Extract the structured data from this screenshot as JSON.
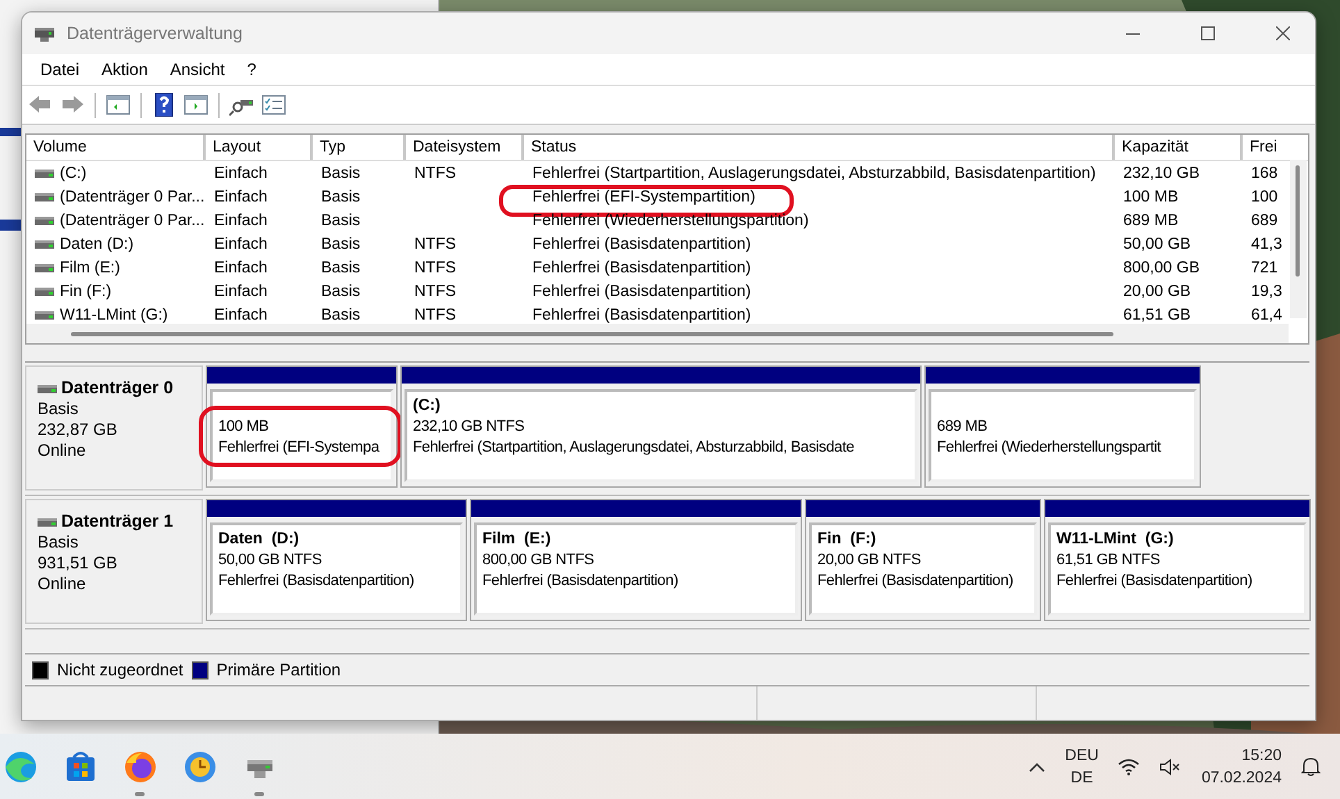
{
  "window": {
    "title": "Datenträgerverwaltung"
  },
  "menu": [
    "Datei",
    "Aktion",
    "Ansicht",
    "?"
  ],
  "volume_table": {
    "columns": [
      "Volume",
      "Layout",
      "Typ",
      "Dateisystem",
      "Status",
      "Kapazität",
      "Frei"
    ],
    "rows": [
      {
        "cells": [
          "(C:)",
          "Einfach",
          "Basis",
          "NTFS",
          "Fehlerfrei (Startpartition, Auslagerungsdatei, Absturzabbild, Basisdatenpartition)",
          "232,10 GB",
          "168"
        ],
        "annotated": false
      },
      {
        "cells": [
          "(Datenträger 0 Par...",
          "Einfach",
          "Basis",
          "",
          "Fehlerfrei (EFI-Systempartition)",
          "100 MB",
          "100"
        ],
        "annotated": true
      },
      {
        "cells": [
          "(Datenträger 0 Par...",
          "Einfach",
          "Basis",
          "",
          "Fehlerfrei (Wiederherstellungspartition)",
          "689 MB",
          "689"
        ],
        "annotated": false
      },
      {
        "cells": [
          "Daten (D:)",
          "Einfach",
          "Basis",
          "NTFS",
          "Fehlerfrei (Basisdatenpartition)",
          "50,00 GB",
          "41,3"
        ],
        "annotated": false
      },
      {
        "cells": [
          "Film (E:)",
          "Einfach",
          "Basis",
          "NTFS",
          "Fehlerfrei (Basisdatenpartition)",
          "800,00 GB",
          "721"
        ],
        "annotated": false
      },
      {
        "cells": [
          "Fin (F:)",
          "Einfach",
          "Basis",
          "NTFS",
          "Fehlerfrei (Basisdatenpartition)",
          "20,00 GB",
          "19,3"
        ],
        "annotated": false
      },
      {
        "cells": [
          "W11-LMint (G:)",
          "Einfach",
          "Basis",
          "NTFS",
          "Fehlerfrei (Basisdatenpartition)",
          "61,51 GB",
          "61,4"
        ],
        "annotated": false
      }
    ]
  },
  "disks": [
    {
      "name": "Datenträger 0",
      "type": "Basis",
      "size": "232,87 GB",
      "status": "Online",
      "partitions": [
        {
          "size": "100 MB",
          "status": "Fehlerfrei (EFI-Systempa",
          "annotated": true
        },
        {
          "title": "(C:)",
          "size": "232,10 GB NTFS",
          "status": "Fehlerfrei (Startpartition, Auslagerungsdatei, Absturzabbild, Basisdate",
          "annotated": false
        },
        {
          "size": "689 MB",
          "status": "Fehlerfrei (Wiederherstellungspartit",
          "annotated": false
        }
      ]
    },
    {
      "name": "Datenträger 1",
      "type": "Basis",
      "size": "931,51 GB",
      "status": "Online",
      "partitions": [
        {
          "title": "Daten  (D:)",
          "size": "50,00 GB NTFS",
          "status": "Fehlerfrei (Basisdatenpartition)",
          "annotated": false
        },
        {
          "title": "Film  (E:)",
          "size": "800,00 GB NTFS",
          "status": "Fehlerfrei (Basisdatenpartition)",
          "annotated": false
        },
        {
          "title": "Fin  (F:)",
          "size": "20,00 GB NTFS",
          "status": "Fehlerfrei (Basisdatenpartition)",
          "annotated": false
        },
        {
          "title": "W11-LMint  (G:)",
          "size": "61,51 GB NTFS",
          "status": "Fehlerfrei (Basisdatenpartition)",
          "annotated": false
        }
      ]
    }
  ],
  "legend": [
    {
      "label": "Nicht zugeordnet",
      "color": "#000000"
    },
    {
      "label": "Primäre Partition",
      "color": "#000080"
    }
  ],
  "taskbar": {
    "apps": [
      {
        "kind": "edge",
        "running": false
      },
      {
        "kind": "store",
        "running": false
      },
      {
        "kind": "firefox",
        "running": true
      },
      {
        "kind": "clock",
        "running": false
      },
      {
        "kind": "disk",
        "running": true
      }
    ],
    "language": "DEU",
    "layout": "DE",
    "time": "15:20",
    "date": "07.02.2024"
  }
}
